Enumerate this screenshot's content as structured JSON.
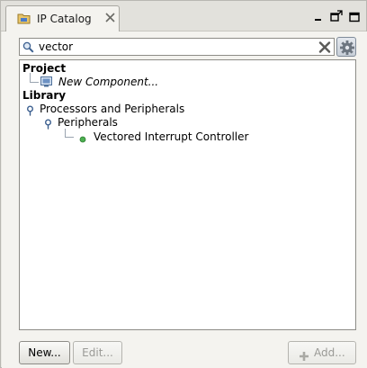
{
  "tab": {
    "title": "IP Catalog"
  },
  "search": {
    "value": "vector"
  },
  "tree": {
    "project_label": "Project",
    "new_component_label": "New Component...",
    "library_label": "Library",
    "processors_label": "Processors and Peripherals",
    "peripherals_label": "Peripherals",
    "vic_label": "Vectored Interrupt Controller"
  },
  "buttons": {
    "new": "New...",
    "edit": "Edit...",
    "add": "Add..."
  },
  "icons": {
    "tab": "folder-icon",
    "close": "close-icon",
    "search": "search-icon",
    "clear": "clear-icon",
    "settings": "gear-icon",
    "component": "component-icon",
    "add": "plus-icon"
  },
  "colors": {
    "accent": "#3b6fb6",
    "ip_dot": "#4caf50"
  }
}
